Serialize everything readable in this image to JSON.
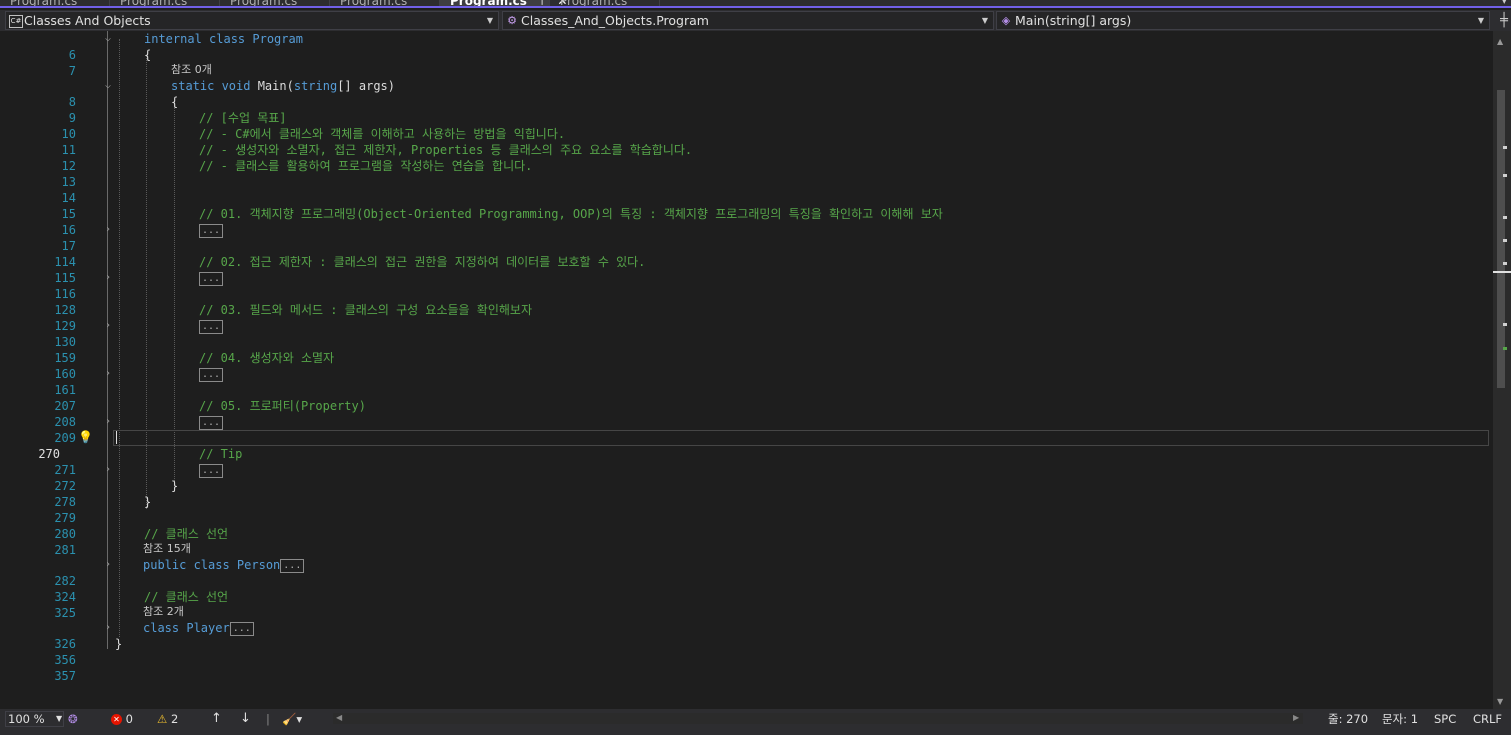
{
  "tabs": [
    {
      "label": "Program.cs"
    },
    {
      "label": "Program.cs"
    },
    {
      "label": "Program.cs"
    },
    {
      "label": "Program.cs",
      "active": true
    },
    {
      "label": "Program.cs"
    }
  ],
  "nav": {
    "project": "Classes And Objects",
    "type": "Classes_And_Objects.Program",
    "member": "Main(string[] args)"
  },
  "code": {
    "l6": {
      "num": "6",
      "kw": "internal class",
      "name": " Program"
    },
    "l7": {
      "num": "7",
      "text": "{"
    },
    "ref0": "참조 0개",
    "l8": {
      "num": "8",
      "kw1": "static void",
      "name": " Main(",
      "kw2": "string",
      "tail": "[] args)"
    },
    "l9": {
      "num": "9",
      "text": "{"
    },
    "l10": {
      "num": "10",
      "text": "// [수업 목표]"
    },
    "l11": {
      "num": "11",
      "text": "// - C#에서 클래스와 객체를 이해하고 사용하는 방법을 익힙니다."
    },
    "l12": {
      "num": "12",
      "text": "// - 생성자와 소멸자, 접근 제한자, Properties 등 클래스의 주요 요소를 학습합니다."
    },
    "l13": {
      "num": "13",
      "text": "// - 클래스를 활용하여 프로그램을 작성하는 연습을 합니다."
    },
    "l14": {
      "num": "14"
    },
    "l15": {
      "num": "15"
    },
    "l16": {
      "num": "16",
      "text": "// 01. 객체지향 프로그래밍(Object-Oriented Programming, OOP)의 특징 : 객체지향 프로그래밍의 특징을 확인하고 이해해 보자"
    },
    "l17": {
      "num": "17"
    },
    "l114": {
      "num": "114"
    },
    "l115": {
      "num": "115",
      "text": "// 02. 접근 제한자 : 클래스의 접근 권한을 지정하여 데이터를 보호할 수 있다."
    },
    "l116": {
      "num": "116"
    },
    "l128": {
      "num": "128"
    },
    "l129": {
      "num": "129",
      "text": "// 03. 필드와 메서드 : 클래스의 구성 요소들을 확인해보자"
    },
    "l130": {
      "num": "130"
    },
    "l159": {
      "num": "159"
    },
    "l160": {
      "num": "160",
      "text": "// 04. 생성자와 소멸자"
    },
    "l161": {
      "num": "161"
    },
    "l207": {
      "num": "207"
    },
    "l208": {
      "num": "208",
      "text": "// 05. 프로퍼티(Property)"
    },
    "l209": {
      "num": "209"
    },
    "l270": {
      "num": "270"
    },
    "l271": {
      "num": "271",
      "text": "// Tip"
    },
    "l272": {
      "num": "272"
    },
    "l278": {
      "num": "278",
      "text": "}"
    },
    "l279": {
      "num": "279",
      "text": "}"
    },
    "l280": {
      "num": "280"
    },
    "l281": {
      "num": "281",
      "text": "// 클래스 선언"
    },
    "ref15": "참조 15개",
    "l282": {
      "num": "282",
      "kw": "public class",
      "name": " Person"
    },
    "l324": {
      "num": "324"
    },
    "l325": {
      "num": "325",
      "text": "// 클래스 선언"
    },
    "ref2": "참조 2개",
    "l326": {
      "num": "326",
      "kw": "class",
      "name": " Player"
    },
    "l356": {
      "num": "356",
      "text": "}"
    },
    "l357": {
      "num": "357"
    },
    "collapsed": "..."
  },
  "status": {
    "zoom": "100 %",
    "errors": "0",
    "warnings": "2",
    "line": "줄: 270",
    "col": "문자: 1",
    "spc": "SPC",
    "crlf": "CRLF"
  },
  "colors": {
    "keyword": "#569cd6",
    "comment": "#57a64a",
    "line_number": "#2b91af",
    "accent": "#7160e8"
  }
}
